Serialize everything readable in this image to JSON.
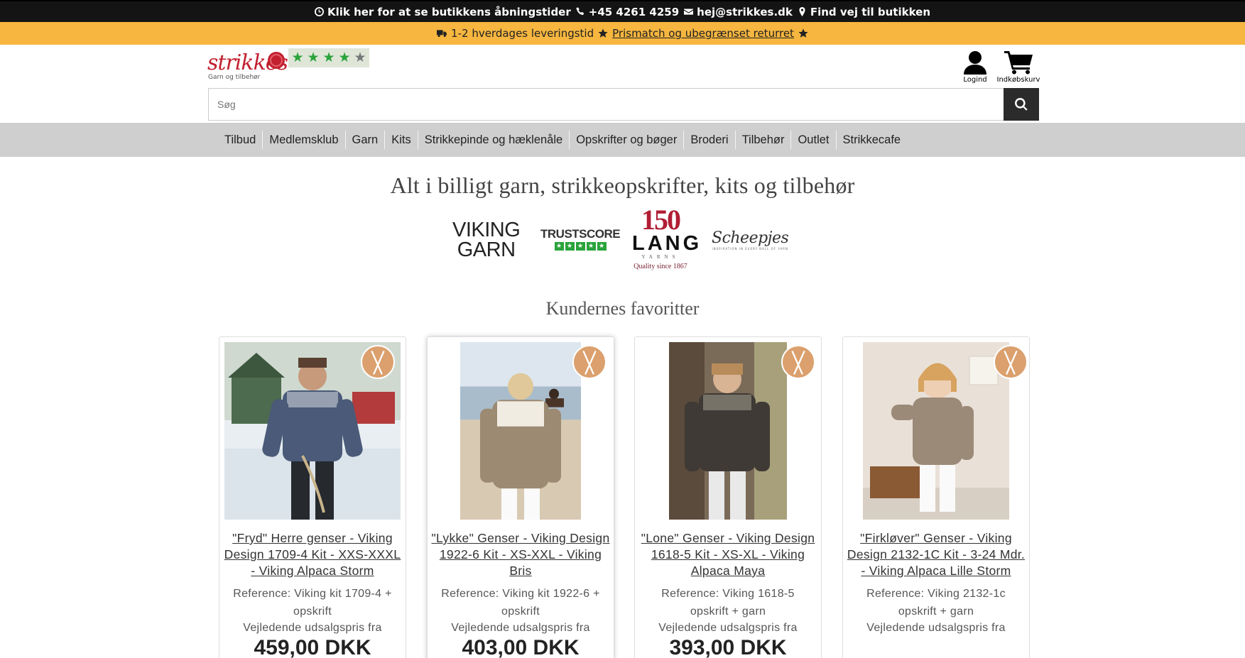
{
  "topbar": {
    "hours": "Klik her for at se butikkens åbningstider",
    "phone": "+45 4261 4259",
    "email": "hej@strikkes.dk",
    "directions": "Find vej til butikken"
  },
  "promo": {
    "delivery": "1-2 hverdages leveringstid",
    "link": "Prismatch og ubegrænset returret"
  },
  "logo": {
    "name": "strikkes",
    "tagline": "Garn og tilbehør"
  },
  "rating": {
    "stars": 4.5
  },
  "header": {
    "login_label": "Logind",
    "cart_label": "Indkøbskurv"
  },
  "search": {
    "placeholder": "Søg"
  },
  "nav": [
    "Tilbud",
    "Medlemsklub",
    "Garn",
    "Kits",
    "Strikkepinde og hæklenåle",
    "Opskrifter og bøger",
    "Broderi",
    "Tilbehør",
    "Outlet",
    "Strikkecafe"
  ],
  "hero_title": "Alt i billigt garn, strikkeopskrifter, kits og tilbehør",
  "brands": {
    "viking": [
      "VIKING",
      "GARN"
    ],
    "trust": "TRUSTSCORE",
    "lang_number": "150",
    "lang_name": "LANG",
    "lang_yarns": "YARNS",
    "lang_quality": "Quality since 1867",
    "scheepjes": "Scheepjes",
    "scheepjes_tag": "INSPIRATION IN EVERY BALL OF YARN"
  },
  "favorites_title": "Kundernes favoritter",
  "products": [
    {
      "title": "\"Fryd\" Herre genser - Viking Design 1709-4 Kit - XXS-XXXL - Viking Alpaca Storm",
      "ref": "Reference: Viking kit 1709-4 + opskrift",
      "price_label": "Vejledende udsalgspris fra",
      "price": "459,00 DKK",
      "sweater": "#4a5a78"
    },
    {
      "title": "\"Lykke\" Genser - Viking Design 1922-6 Kit - XS-XXL - Viking Bris",
      "ref": "Reference: Viking kit 1922-6 + opskrift",
      "price_label": "Vejledende udsalgspris fra",
      "price": "403,00 DKK",
      "sweater": "#9c8a72"
    },
    {
      "title": "\"Lone\" Genser - Viking Design 1618-5 Kit - XS-XL - Viking Alpaca Maya",
      "ref": "Reference: Viking 1618-5 opskrift + garn",
      "price_label": "Vejledende udsalgspris fra",
      "price": "393,00 DKK",
      "sweater": "#3f3a35"
    },
    {
      "title": "\"Firkløver\" Genser - Viking Design 2132-1C Kit - 3-24 Mdr. - Viking Alpaca Lille Storm",
      "ref": "Reference: Viking 2132-1c opskrift + garn",
      "price_label": "Vejledende udsalgspris fra",
      "price": "",
      "sweater": "#9b8a78"
    }
  ]
}
